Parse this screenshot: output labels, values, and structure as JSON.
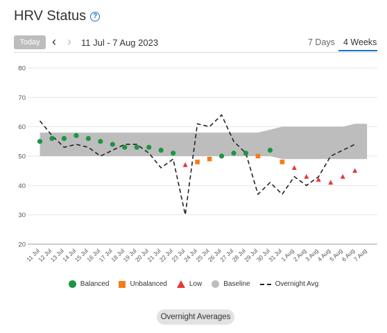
{
  "header": {
    "title": "HRV Status",
    "help_icon": "question-circle-icon"
  },
  "nav": {
    "today_label": "Today",
    "date_range": "11 Jul - 7 Aug 2023",
    "prev_icon": "chevron-left-icon",
    "next_icon": "chevron-right-icon"
  },
  "tabs": [
    {
      "label": "7 Days",
      "active": false
    },
    {
      "label": "4 Weeks",
      "active": true
    }
  ],
  "legend": [
    {
      "label": "Balanced",
      "color": "#1a9641",
      "shape": "circle"
    },
    {
      "label": "Unbalanced",
      "color": "#f07f1a",
      "shape": "square"
    },
    {
      "label": "Low",
      "color": "#e53935",
      "shape": "triangle"
    },
    {
      "label": "Baseline",
      "color": "#bdbdbd",
      "shape": "circle"
    },
    {
      "label": "Overnight Avg",
      "color": "#222222",
      "shape": "dashed-line"
    }
  ],
  "footer": {
    "button_label": "Overnight Averages"
  },
  "chart_data": {
    "type": "scatter",
    "title": "",
    "xlabel": "",
    "ylabel": "",
    "ylim": [
      20,
      80
    ],
    "yticks": [
      20,
      30,
      40,
      50,
      60,
      70,
      80
    ],
    "grid": true,
    "legend_position": "bottom",
    "categories": [
      "11 Jul",
      "12 Jul",
      "13 Jul",
      "14 Jul",
      "15 Jul",
      "16 Jul",
      "17 Jul",
      "18 Jul",
      "19 Jul",
      "20 Jul",
      "21 Jul",
      "22 Jul",
      "23 Jul",
      "24 Jul",
      "25 Jul",
      "26 Jul",
      "27 Jul",
      "28 Jul",
      "29 Jul",
      "30 Jul",
      "31 Jul",
      "1 Aug",
      "2 Aug",
      "3 Aug",
      "4 Aug",
      "5 Aug",
      "6 Aug",
      "7 Aug"
    ],
    "baseline": {
      "name": "Baseline",
      "upper": [
        58,
        58,
        58,
        58,
        58,
        58,
        58,
        58,
        58,
        58,
        58,
        58,
        58,
        58,
        58,
        58,
        58,
        58,
        58,
        59,
        60,
        60,
        60,
        60,
        60,
        60,
        61,
        61
      ],
      "lower": [
        50,
        50,
        50,
        50,
        50,
        50,
        50,
        50,
        50,
        50,
        50,
        50,
        50,
        50,
        50,
        50,
        50,
        50,
        50,
        50,
        49,
        49,
        49,
        49,
        49,
        49,
        49,
        49
      ]
    },
    "points": [
      {
        "x": "11 Jul",
        "y": 55,
        "status": "Balanced"
      },
      {
        "x": "12 Jul",
        "y": 56,
        "status": "Balanced"
      },
      {
        "x": "13 Jul",
        "y": 56,
        "status": "Balanced"
      },
      {
        "x": "14 Jul",
        "y": 57,
        "status": "Balanced"
      },
      {
        "x": "15 Jul",
        "y": 56,
        "status": "Balanced"
      },
      {
        "x": "16 Jul",
        "y": 55,
        "status": "Balanced"
      },
      {
        "x": "17 Jul",
        "y": 54,
        "status": "Balanced"
      },
      {
        "x": "18 Jul",
        "y": 53,
        "status": "Balanced"
      },
      {
        "x": "19 Jul",
        "y": 53,
        "status": "Balanced"
      },
      {
        "x": "20 Jul",
        "y": 53,
        "status": "Balanced"
      },
      {
        "x": "21 Jul",
        "y": 52,
        "status": "Balanced"
      },
      {
        "x": "22 Jul",
        "y": 51,
        "status": "Balanced"
      },
      {
        "x": "23 Jul",
        "y": 47,
        "status": "Low"
      },
      {
        "x": "24 Jul",
        "y": 48,
        "status": "Unbalanced"
      },
      {
        "x": "25 Jul",
        "y": 49,
        "status": "Unbalanced"
      },
      {
        "x": "26 Jul",
        "y": 50,
        "status": "Balanced"
      },
      {
        "x": "27 Jul",
        "y": 51,
        "status": "Balanced"
      },
      {
        "x": "28 Jul",
        "y": 51,
        "status": "Balanced"
      },
      {
        "x": "29 Jul",
        "y": 50,
        "status": "Unbalanced"
      },
      {
        "x": "30 Jul",
        "y": 52,
        "status": "Balanced"
      },
      {
        "x": "31 Jul",
        "y": 48,
        "status": "Unbalanced"
      },
      {
        "x": "1 Aug",
        "y": 46,
        "status": "Low"
      },
      {
        "x": "2 Aug",
        "y": 43,
        "status": "Low"
      },
      {
        "x": "3 Aug",
        "y": 42,
        "status": "Low"
      },
      {
        "x": "4 Aug",
        "y": 41,
        "status": "Low"
      },
      {
        "x": "5 Aug",
        "y": 43,
        "status": "Low"
      },
      {
        "x": "6 Aug",
        "y": 45,
        "status": "Low"
      }
    ],
    "overnight_avg": {
      "name": "Overnight Avg",
      "values": [
        62,
        57,
        53,
        54,
        53,
        50,
        52,
        54,
        54,
        51,
        46,
        49,
        30,
        61,
        60,
        64,
        55,
        51,
        37,
        41,
        37,
        43,
        40,
        43,
        50,
        52,
        54,
        null
      ]
    }
  }
}
